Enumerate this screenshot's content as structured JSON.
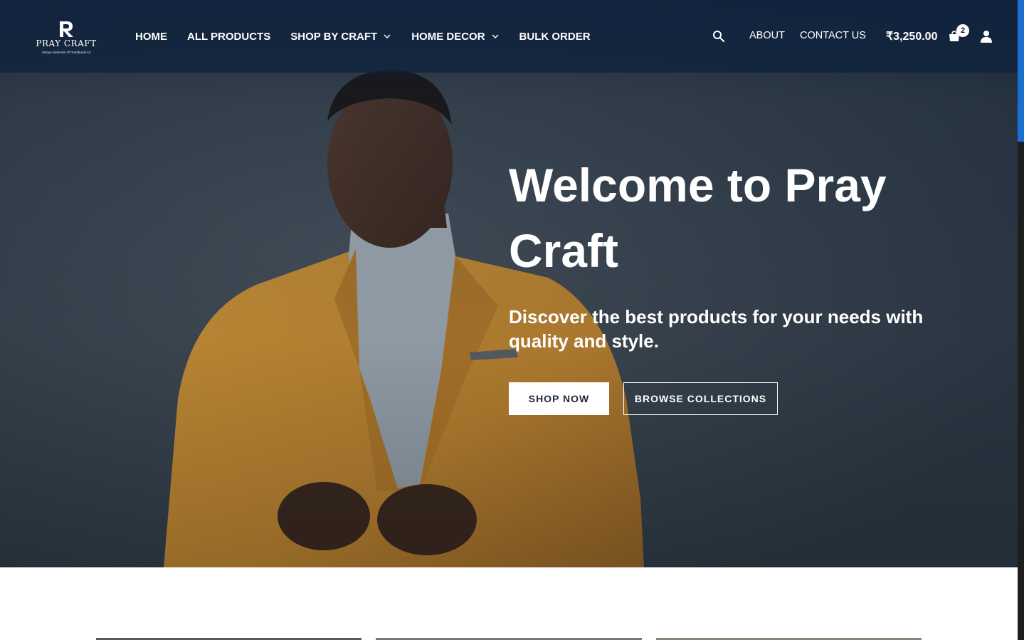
{
  "brand": {
    "name": "PRAY CRAFT",
    "tagline": "Unique Selection Of Traditional Art"
  },
  "nav": {
    "items": [
      {
        "label": "HOME",
        "has_dropdown": false
      },
      {
        "label": "ALL PRODUCTS",
        "has_dropdown": false
      },
      {
        "label": "SHOP BY CRAFT",
        "has_dropdown": true
      },
      {
        "label": "HOME DECOR",
        "has_dropdown": true
      },
      {
        "label": "BULK ORDER",
        "has_dropdown": false
      }
    ],
    "about": "ABOUT",
    "contact": "CONTACT US",
    "cart_total": "₹3,250.00",
    "cart_count": "2",
    "icons": [
      "search-icon",
      "shopping-bag-icon",
      "user-icon",
      "chevron-down-icon"
    ]
  },
  "hero": {
    "title": "Welcome to Pray Craft",
    "subtitle": "Discover the best products for your needs with quality and style.",
    "primary_cta": "SHOP NOW",
    "secondary_cta": "BROWSE COLLECTIONS"
  },
  "colors": {
    "header_bg": "#0f233e",
    "scroll_thumb": "#1a6fd1",
    "jacket": "#c98a2a"
  }
}
